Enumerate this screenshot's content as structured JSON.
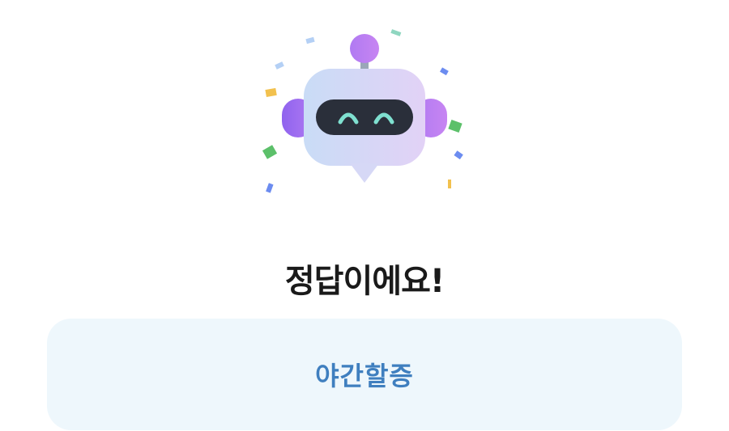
{
  "result": {
    "title": "정답이에요!"
  },
  "answer": {
    "label": "야간할증"
  },
  "mascot": {
    "icon": "robot-celebrating-icon",
    "expression": "happy-eyes",
    "colors": {
      "body_start": "#cfe0f7",
      "body_end": "#e3d4f7",
      "visor": "#2a2f3a",
      "eyes": "#7fe0d0",
      "ears": "#a46ef0",
      "antenna_ball": "#a46ef0"
    }
  },
  "colors": {
    "title_text": "#1a1a1a",
    "answer_text": "#3f7fbf",
    "answer_card_bg": "#eef7fc",
    "confetti": [
      "#f2c14e",
      "#5cc06a",
      "#6c8cf0",
      "#b4d0f5",
      "#8fd6c0"
    ]
  }
}
